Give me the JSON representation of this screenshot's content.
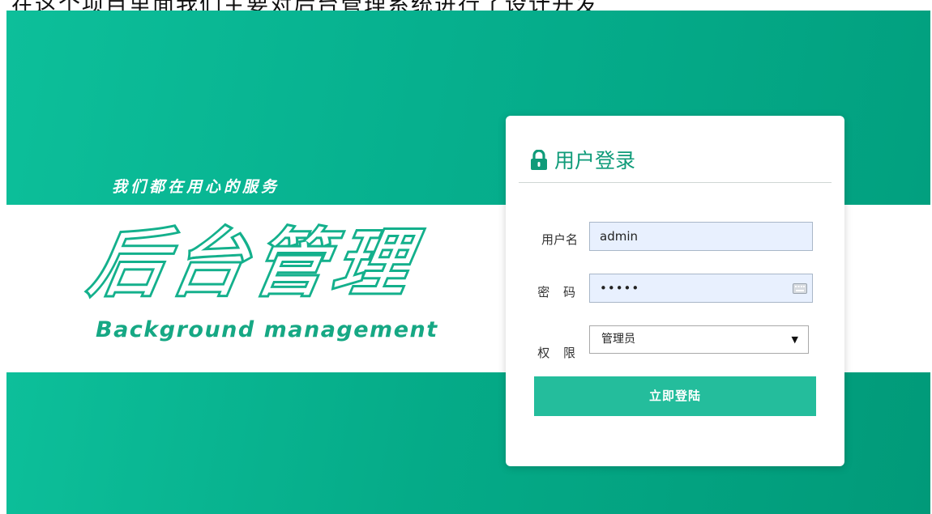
{
  "caption": "在这个项目里面我们主要对后台管理系统进行了设计开发",
  "banner": {
    "slogan": "我们都在用心的服务",
    "logo_cn": "后台管理",
    "logo_en": "Background management"
  },
  "login": {
    "title": "用户登录",
    "username_label": "用户名",
    "username_value": "admin",
    "password_label": "密 码",
    "password_value": "•••••",
    "role_label": "权 限",
    "role_value": "管理员",
    "submit_label": "立即登陆"
  },
  "colors": {
    "brand": "#0dbf9a",
    "title": "#0f9b79",
    "button": "#24bd9c"
  },
  "icons": {
    "lock": "lock-icon",
    "keyboard": "keyboard-icon",
    "dropdown": "dropdown-arrow-icon"
  }
}
